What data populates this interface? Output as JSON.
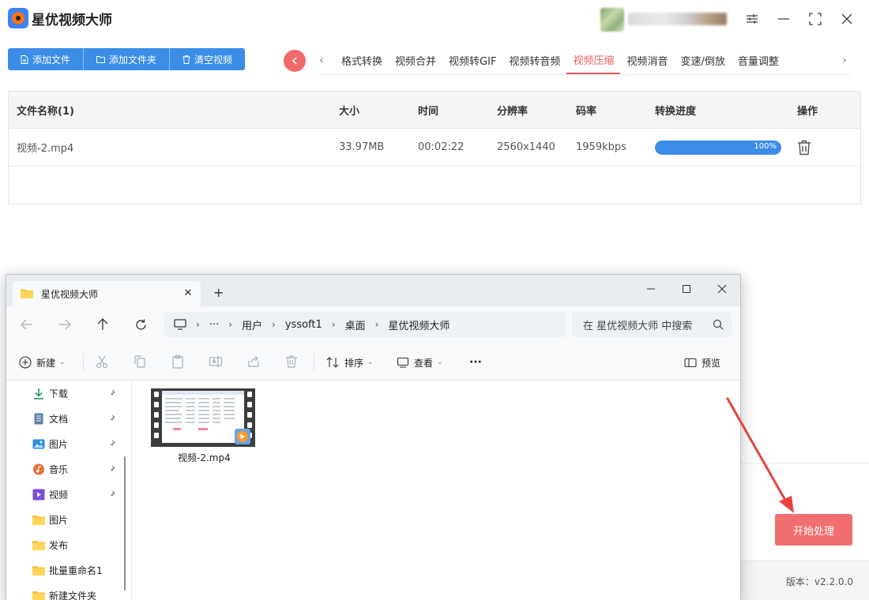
{
  "app": {
    "title": "星优视频大师",
    "toolbar": {
      "add_file": "添加文件",
      "add_folder": "添加文件夹",
      "clear_videos": "清空视频"
    },
    "tabs": [
      "格式转换",
      "视频合并",
      "视频转GIF",
      "视频转音频",
      "视频压缩",
      "视频消音",
      "变速/倒放",
      "音量调整"
    ],
    "active_tab": "视频压缩",
    "table": {
      "headers": {
        "name": "文件名称(1)",
        "size": "大小",
        "duration": "时间",
        "resolution": "分辨率",
        "bitrate": "码率",
        "progress": "转换进度",
        "action": "操作"
      },
      "rows": [
        {
          "name": "视频-2.mp4",
          "size": "33.97MB",
          "duration": "00:02:22",
          "resolution": "2560x1440",
          "bitrate": "1959kbps",
          "progress": 100,
          "progress_label": "100%"
        }
      ]
    },
    "start_button": "开始处理",
    "version": "版本：v2.2.0.0",
    "colors": {
      "accent_blue": "#3b8de6",
      "accent_red": "#f16f6f"
    }
  },
  "explorer": {
    "tab_title": "星优视频大师",
    "breadcrumb": [
      "用户",
      "yssoft1",
      "桌面",
      "星优视频大师"
    ],
    "search_placeholder": "在 星优视频大师 中搜索",
    "commands": {
      "new": "新建",
      "sort": "排序",
      "view": "查看",
      "more": "···",
      "preview": "预览"
    },
    "sidebar": [
      {
        "label": "下载",
        "icon": "download-icon",
        "pinned": true
      },
      {
        "label": "文档",
        "icon": "document-icon",
        "pinned": true
      },
      {
        "label": "图片",
        "icon": "pictures-icon",
        "pinned": true
      },
      {
        "label": "音乐",
        "icon": "music-icon",
        "pinned": true
      },
      {
        "label": "视频",
        "icon": "videos-icon",
        "pinned": true
      },
      {
        "label": "图片",
        "icon": "folder-icon",
        "pinned": false
      },
      {
        "label": "发布",
        "icon": "folder-icon",
        "pinned": false
      },
      {
        "label": "批量重命名1",
        "icon": "folder-icon",
        "pinned": false
      },
      {
        "label": "新建文件夹",
        "icon": "folder-icon",
        "pinned": false
      }
    ],
    "files": [
      {
        "name": "视频-2.mp4",
        "icon": "video-file-icon"
      }
    ]
  }
}
